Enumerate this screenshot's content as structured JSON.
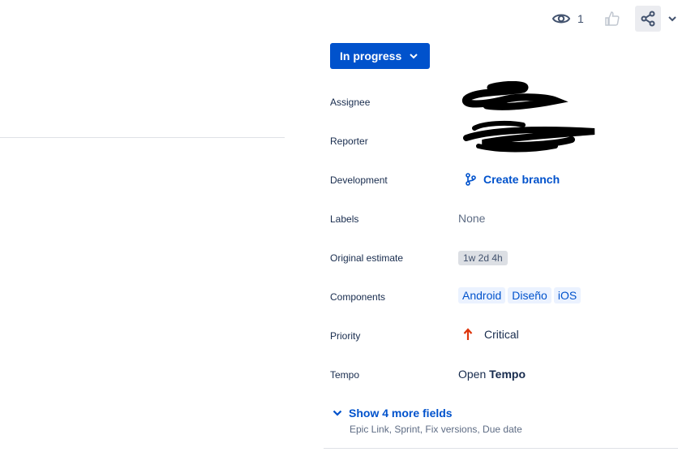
{
  "toolbar": {
    "watch_count": "1"
  },
  "status": {
    "label": "In progress"
  },
  "fields": {
    "assignee_label": "Assignee",
    "reporter_label": "Reporter",
    "development_label": "Development",
    "development_value": "Create branch",
    "labels_label": "Labels",
    "labels_value": "None",
    "estimate_label": "Original estimate",
    "estimate_value": "1w 2d 4h",
    "components_label": "Components",
    "components": [
      "Android",
      "Diseño",
      "iOS"
    ],
    "priority_label": "Priority",
    "priority_value": "Critical",
    "tempo_label": "Tempo",
    "tempo_open": "Open",
    "tempo_name": "Tempo"
  },
  "show_more": {
    "label": "Show 4 more fields",
    "hint": "Epic Link, Sprint, Fix versions, Due date"
  },
  "colors": {
    "accent": "#0052cc",
    "priority_critical": "#de350b"
  }
}
